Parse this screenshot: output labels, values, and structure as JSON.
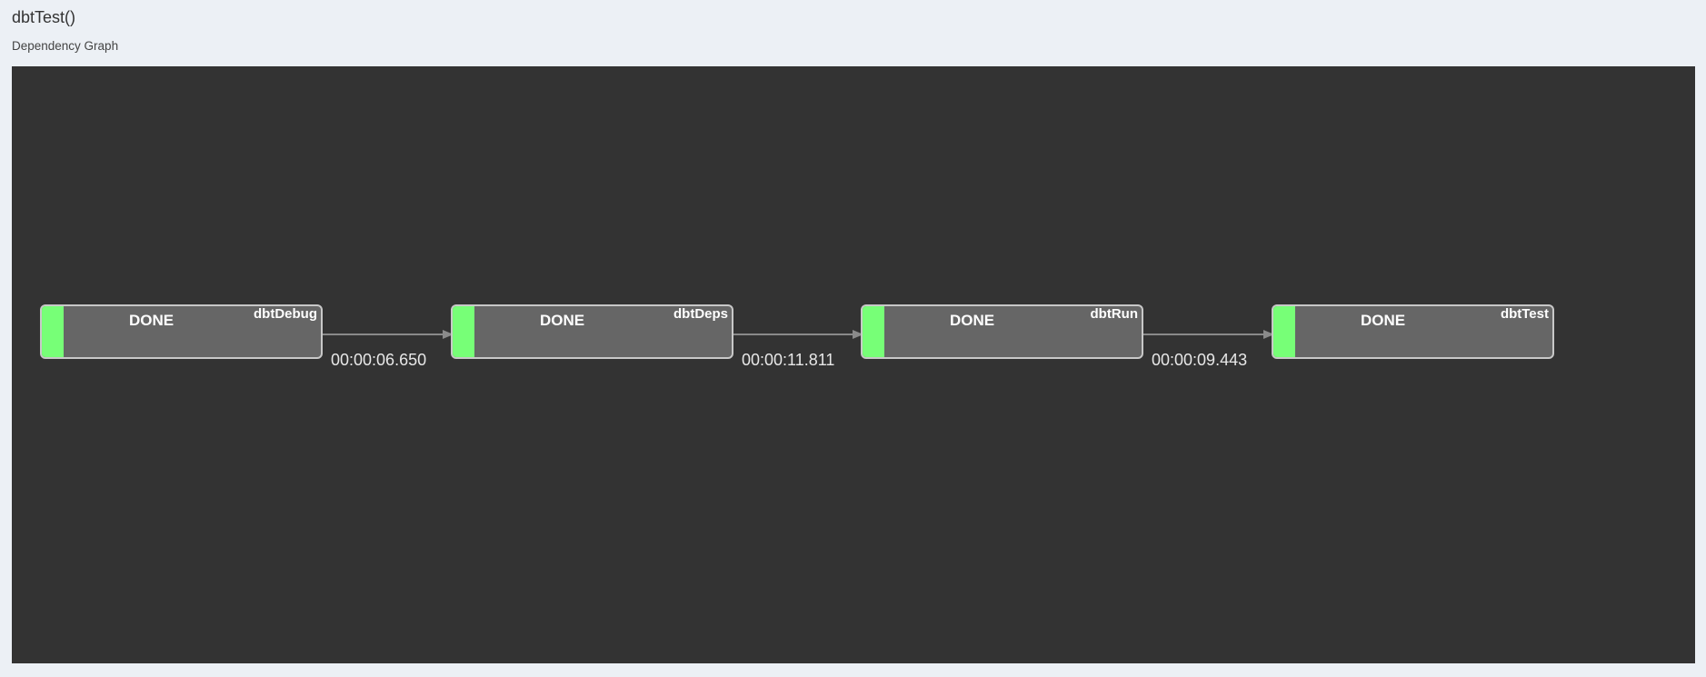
{
  "page": {
    "title": "dbtTest()",
    "section_title": "Dependency Graph"
  },
  "graph": {
    "status_color": "#77ff77",
    "nodes": [
      {
        "name": "dbtDebug",
        "status": "DONE"
      },
      {
        "name": "dbtDeps",
        "status": "DONE"
      },
      {
        "name": "dbtRun",
        "status": "DONE"
      },
      {
        "name": "dbtTest",
        "status": "DONE"
      }
    ],
    "edges": [
      {
        "from": "dbtDebug",
        "to": "dbtDeps",
        "duration": "00:00:06.650"
      },
      {
        "from": "dbtDeps",
        "to": "dbtRun",
        "duration": "00:00:11.811"
      },
      {
        "from": "dbtRun",
        "to": "dbtTest",
        "duration": "00:00:09.443"
      }
    ]
  }
}
